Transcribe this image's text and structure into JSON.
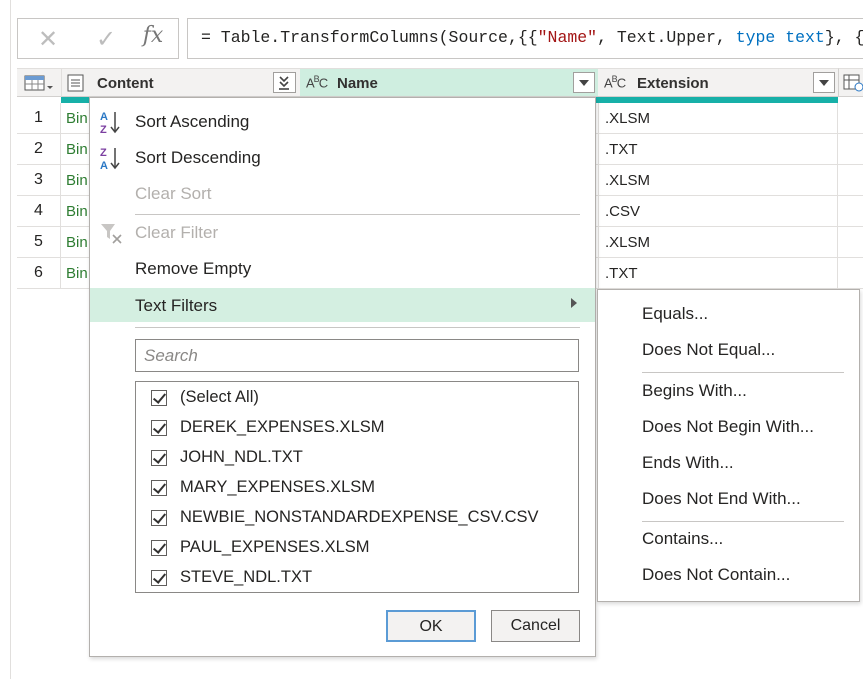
{
  "formula": {
    "cancel_icon": "close-icon",
    "commit_icon": "check-icon",
    "fx_label": "fx",
    "text_parts": [
      {
        "t": "= Table.TransformColumns(Source,{{",
        "c": ""
      },
      {
        "t": "\"Name\"",
        "c": "str"
      },
      {
        "t": ", Text.Upper, ",
        "c": ""
      },
      {
        "t": "type",
        "c": "kw"
      },
      {
        "t": " ",
        "c": ""
      },
      {
        "t": "text",
        "c": "kw"
      },
      {
        "t": "}, {",
        "c": ""
      }
    ]
  },
  "columns": {
    "content": {
      "label": "Content"
    },
    "name": {
      "label": "Name",
      "type": "ABC"
    },
    "extension": {
      "label": "Extension",
      "type": "ABC"
    }
  },
  "rows": [
    {
      "num": "1",
      "content": "Bin",
      "ext": ".XLSM"
    },
    {
      "num": "2",
      "content": "Bin",
      "ext": ".TXT"
    },
    {
      "num": "3",
      "content": "Bin",
      "ext": ".XLSM"
    },
    {
      "num": "4",
      "content": "Bin",
      "ext": ".CSV"
    },
    {
      "num": "5",
      "content": "Bin",
      "ext": ".XLSM"
    },
    {
      "num": "6",
      "content": "Bin",
      "ext": ".TXT"
    }
  ],
  "menu": {
    "sort_asc": "Sort Ascending",
    "sort_desc": "Sort Descending",
    "clear_sort": "Clear Sort",
    "clear_filter": "Clear Filter",
    "remove_empty": "Remove Empty",
    "text_filters": "Text Filters",
    "search_placeholder": "Search",
    "items": [
      "(Select All)",
      "DEREK_EXPENSES.XLSM",
      "JOHN_NDL.TXT",
      "MARY_EXPENSES.XLSM",
      "NEWBIE_NONSTANDARDEXPENSE_CSV.CSV",
      "PAUL_EXPENSES.XLSM",
      "STEVE_NDL.TXT"
    ],
    "ok": "OK",
    "cancel": "Cancel"
  },
  "submenu": {
    "equals": "Equals...",
    "not_equal": "Does Not Equal...",
    "begins": "Begins With...",
    "not_begin": "Does Not Begin With...",
    "ends": "Ends With...",
    "not_end": "Does Not End With...",
    "contains": "Contains...",
    "not_contain": "Does Not Contain..."
  },
  "colors": {
    "accent": "#17b0a8",
    "highlight": "#d4efe1",
    "link_green": "#2e7d32"
  }
}
